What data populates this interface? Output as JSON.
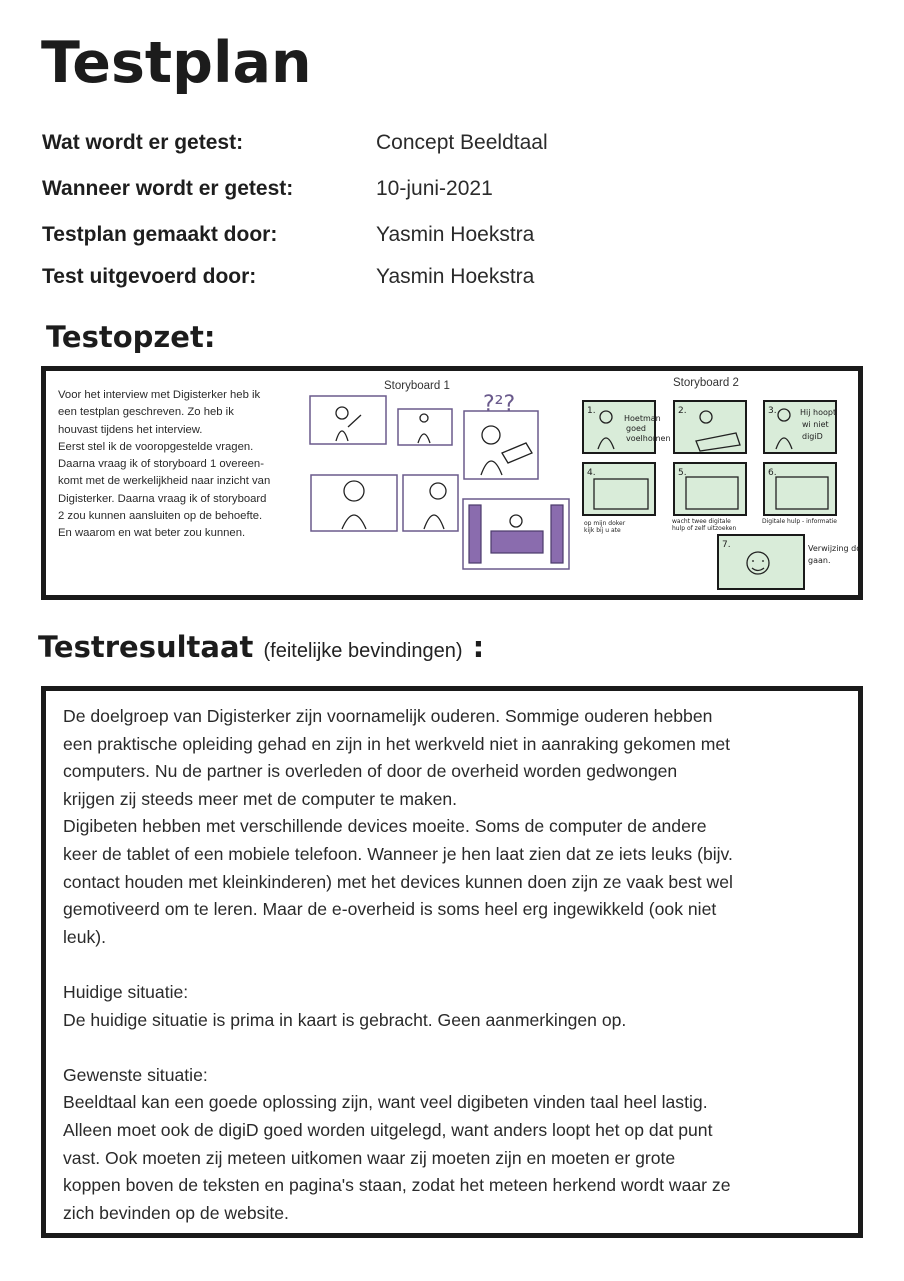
{
  "title": "Testplan",
  "meta": [
    {
      "label": "Wat wordt er getest:",
      "value": "Concept Beeldtaal"
    },
    {
      "label": "Wanneer wordt er getest:",
      "value": "10-juni-2021"
    },
    {
      "label": "Testplan gemaakt door:",
      "value": "Yasmin Hoekstra"
    },
    {
      "label": "Test uitgevoerd door:",
      "value": "Yasmin Hoekstra"
    }
  ],
  "testopzet": {
    "heading": "Testopzet:",
    "text": "Voor het interview met Digisterker heb ik\neen testplan geschreven. Zo heb ik\nhouvast tijdens het interview.\nEerst stel ik de vooropgestelde vragen.\nDaarna vraag ik of storyboard 1 overeen-\nkomt met de werkelijkheid naar inzicht van\nDigisterker. Daarna vraag ik of storyboard\n2 zou kunnen aansluiten op de behoefte.\nEn waarom en wat beter zou kunnen.",
    "storyboard1_label": "Storyboard 1",
    "storyboard2_label": "Storyboard 2"
  },
  "testresultaat": {
    "heading": "Testresultaat",
    "subheading": "(feitelijke bevindingen)",
    "colon": ":",
    "text": "De doelgroep van Digisterker zijn voornamelijk ouderen. Sommige ouderen hebben\neen praktische opleiding gehad en zijn in het werkveld niet in aanraking gekomen met\ncomputers. Nu de partner is overleden of door de overheid worden gedwongen\nkrijgen zij steeds meer met de computer te maken.\nDigibeten hebben met verschillende devices moeite. Soms de computer de andere\nkeer de tablet of een mobiele telefoon. Wanneer je hen laat zien dat ze iets leuks (bijv.\ncontact houden met kleinkinderen) met het devices kunnen doen zijn ze vaak best wel\ngemotiveerd om te leren. Maar de e-overheid is soms heel erg ingewikkeld (ook niet\nleuk).\n\nHuidige situatie:\n De huidige situatie is prima in kaart is gebracht. Geen aanmerkingen op.\n\nGewenste situatie:\nBeeldtaal kan een goede oplossing zijn, want veel digibeten vinden taal heel lastig.\nAlleen moet ook de digiD goed worden uitgelegd, want anders loopt het op dat punt\nvast. Ook moeten zij meteen uitkomen waar zij moeten zijn en moeten er grote\nkoppen boven de teksten en pagina's staan, zodat het meteen herkend wordt waar ze\nzich bevinden op de website."
  },
  "colors": {
    "border": "#1a1a1a",
    "sketch_green": "#d9ecd9",
    "sketch_purple": "#8a6cae"
  }
}
